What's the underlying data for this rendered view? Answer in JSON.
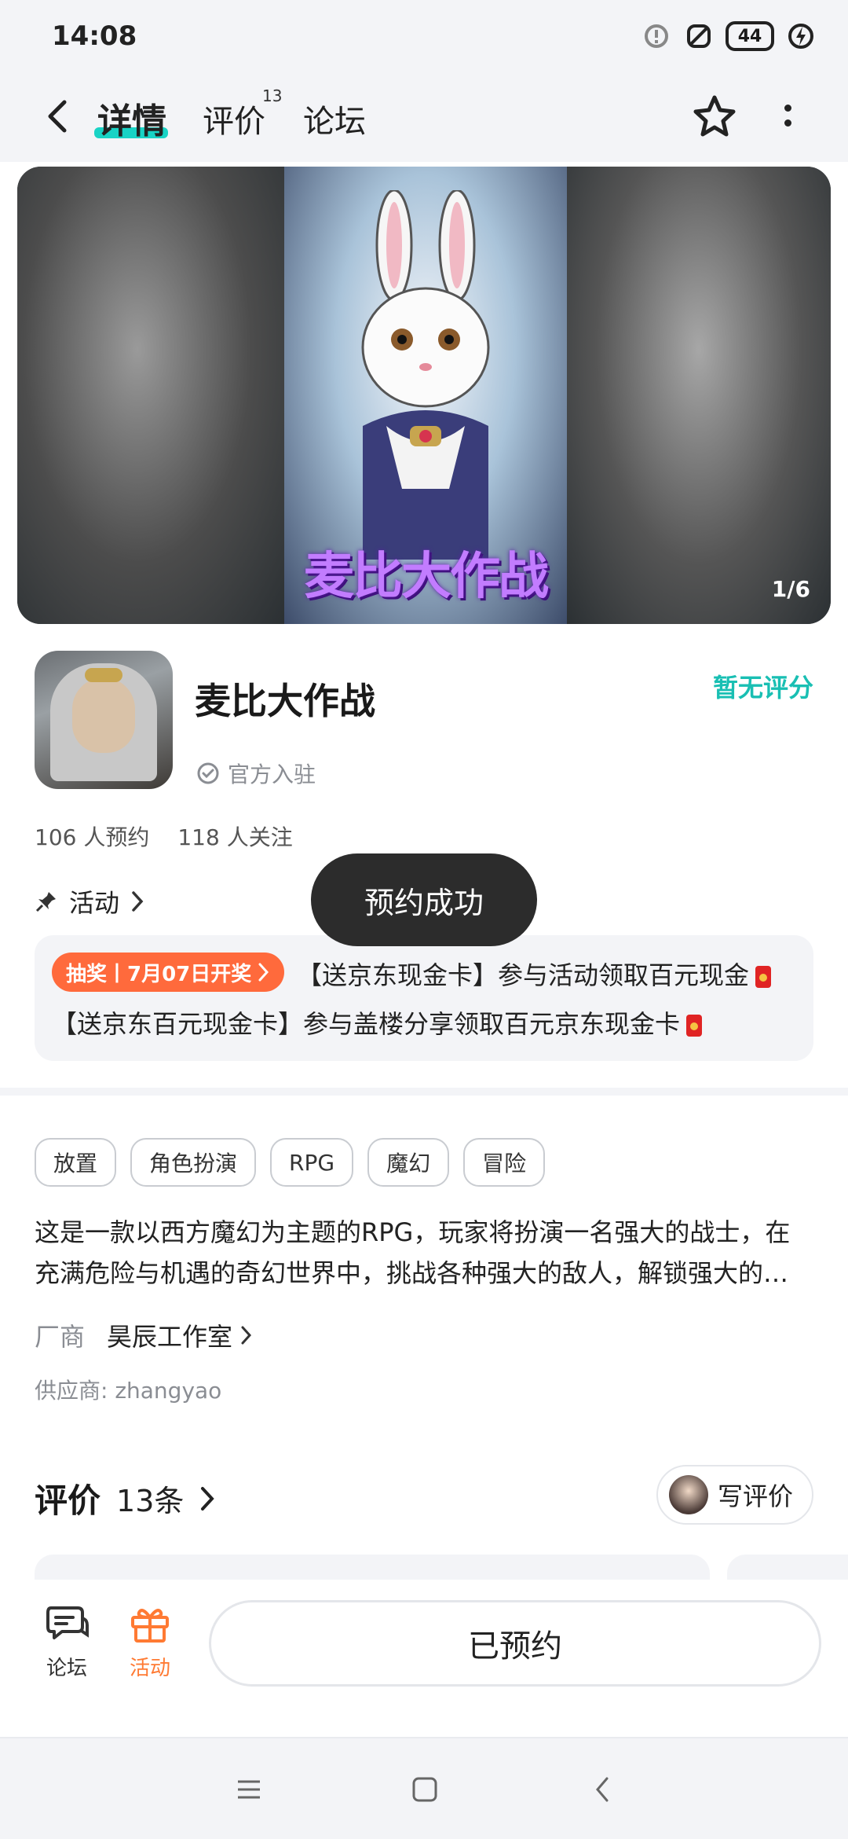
{
  "status_bar": {
    "time": "14:08",
    "battery": "44"
  },
  "header": {
    "tabs": [
      {
        "label": "详情"
      },
      {
        "label": "评价",
        "badge": "13"
      },
      {
        "label": "论坛"
      }
    ]
  },
  "banner": {
    "logo_text": "麦比大作战",
    "counter": "1/6"
  },
  "app": {
    "title": "麦比大作战",
    "official_label": "官方入驻",
    "rating": "暂无评分",
    "reservations": "106 人预约",
    "followers": "118 人关注"
  },
  "activity": {
    "label": "活动",
    "toast": "预约成功",
    "badge": "抽奖丨7月07日开奖",
    "line1": "【送京东现金卡】参与活动领取百元现金",
    "line2": "【送京东百元现金卡】参与盖楼分享领取百元京东现金卡"
  },
  "tags": [
    "放置",
    "角色扮演",
    "RPG",
    "魔幻",
    "冒险"
  ],
  "description": "这是一款以西方魔幻为主题的RPG，玩家将扮演一名强大的战士，在充满危险与机遇的奇幻世界中，挑战各种强大的敌人，解锁强大的…",
  "vendor": {
    "label": "厂商",
    "name": "昊辰工作室"
  },
  "supplier": "供应商: zhangyao",
  "reviews": {
    "title": "评价",
    "count": "13条",
    "write_label": "写评价"
  },
  "bottom_bar": {
    "forum_label": "论坛",
    "activity_label": "活动",
    "reserved_label": "已预约"
  },
  "colors": {
    "accent": "#19d3c5",
    "rating": "#19bfb3",
    "orange": "#ff6a3c",
    "toast_bg": "#2c2c2c"
  }
}
